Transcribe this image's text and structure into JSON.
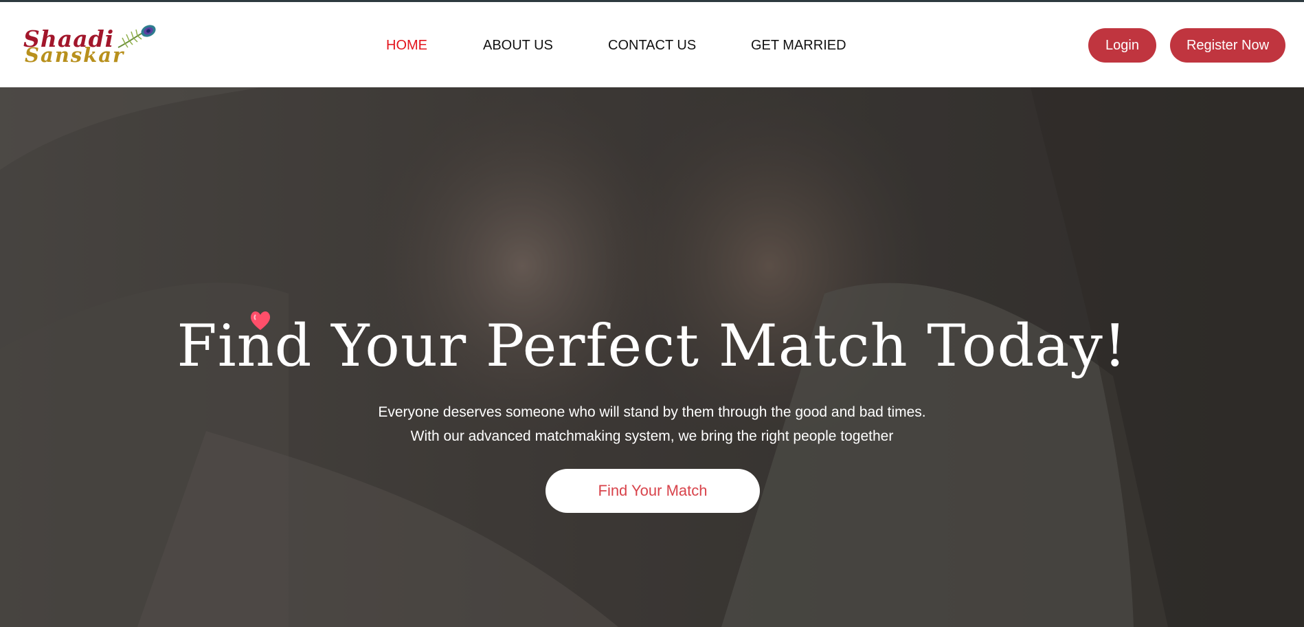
{
  "brand": {
    "line1": "Shaadi",
    "line2": "Sanskar",
    "logo_icon": "peacock-feather-icon"
  },
  "nav": {
    "items": [
      {
        "label": "HOME",
        "active": true
      },
      {
        "label": "ABOUT US",
        "active": false
      },
      {
        "label": "CONTACT US",
        "active": false
      },
      {
        "label": "GET MARRIED",
        "active": false
      }
    ]
  },
  "auth": {
    "login_label": "Login",
    "register_label": "Register Now"
  },
  "hero": {
    "title": "Find Your Perfect Match Today!",
    "subtitle": "Everyone deserves someone who will stand by them through the good and bad times. With our advanced matchmaking system, we bring the right people together",
    "cta_label": "Find Your Match",
    "decor_icon": "heart-icon"
  },
  "colors": {
    "accent": "#c0353f",
    "active_nav": "#e3141c",
    "cta_text": "#d8434b",
    "brand_red": "#a2162b",
    "brand_gold": "#b8901d"
  }
}
